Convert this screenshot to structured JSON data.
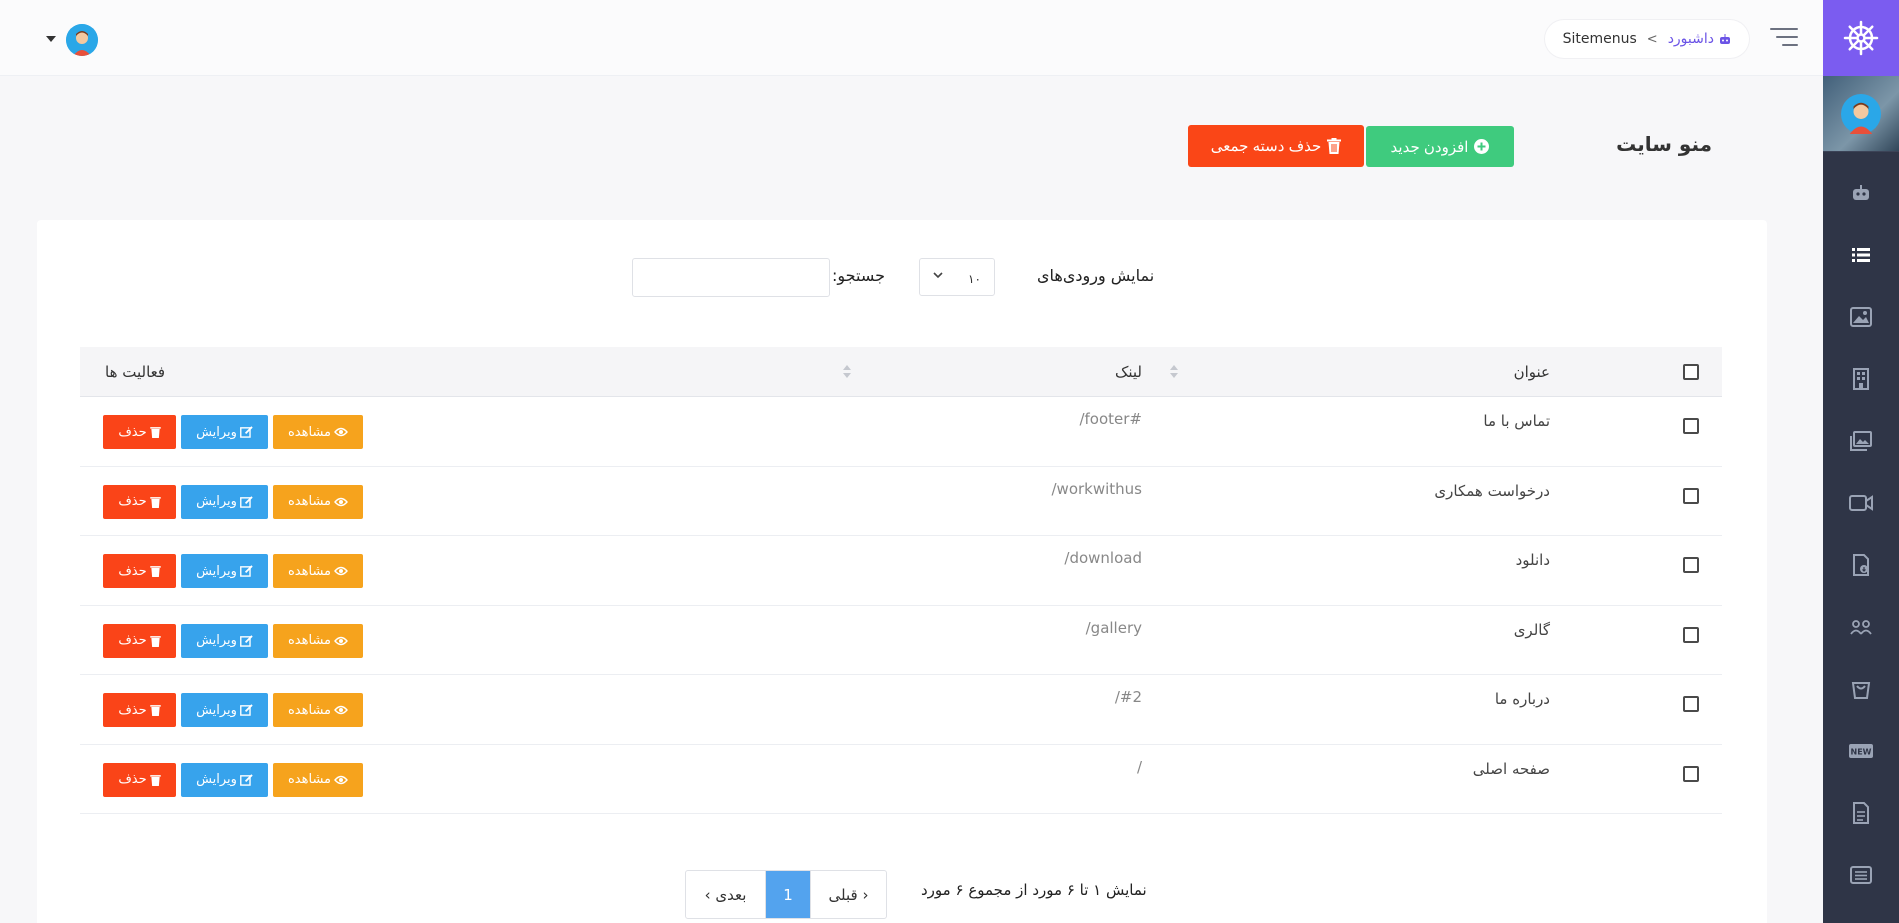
{
  "header": {
    "breadcrumb": {
      "home_label": "داشبورد",
      "separator": ">",
      "current": "Sitemenus"
    }
  },
  "sidebar": {
    "items": [
      {
        "icon": "robot-icon"
      },
      {
        "icon": "list-icon",
        "active": true
      },
      {
        "icon": "image-icon"
      },
      {
        "icon": "building-icon"
      },
      {
        "icon": "photos-icon"
      },
      {
        "icon": "video-icon"
      },
      {
        "icon": "download-file-icon"
      },
      {
        "icon": "users-icon"
      },
      {
        "icon": "bag-icon"
      },
      {
        "icon": "new-badge-icon"
      },
      {
        "icon": "document-icon"
      },
      {
        "icon": "list-alt-icon"
      }
    ]
  },
  "page": {
    "title": "منو سایت",
    "add_button": "افزودن جدید",
    "bulk_delete_button": "حذف دسته جمعی"
  },
  "controls": {
    "length_label": "نمایش ورودی‌های",
    "length_value": "۱۰",
    "search_label": "جستجو:",
    "search_value": ""
  },
  "table": {
    "columns": {
      "title": "عنوان",
      "link": "لینک",
      "actions": "فعالیت ها"
    },
    "action_labels": {
      "view": "مشاهده",
      "edit": "ویرایش",
      "delete": "حذف"
    },
    "rows": [
      {
        "title": "تماس با ما",
        "link": "/footer#"
      },
      {
        "title": "درخواست همکاری",
        "link": "/workwithus"
      },
      {
        "title": "دانلود",
        "link": "/download"
      },
      {
        "title": "گالری",
        "link": "/gallery"
      },
      {
        "title": "درباره ما",
        "link": "/#2"
      },
      {
        "title": "صفحه اصلی",
        "link": "/"
      }
    ]
  },
  "footer": {
    "info": "نمایش ۱ تا ۶ مورد از مجموع ۶ مورد",
    "prev": "قبلی",
    "page": "1",
    "next": "بعدی"
  },
  "colors": {
    "brand": "#7b5cf0",
    "sidebar": "#2f3547",
    "add": "#3fcb7e",
    "delete": "#fa4617",
    "view": "#f6a31d",
    "edit": "#37a3ec",
    "page_active": "#53a3ee"
  }
}
